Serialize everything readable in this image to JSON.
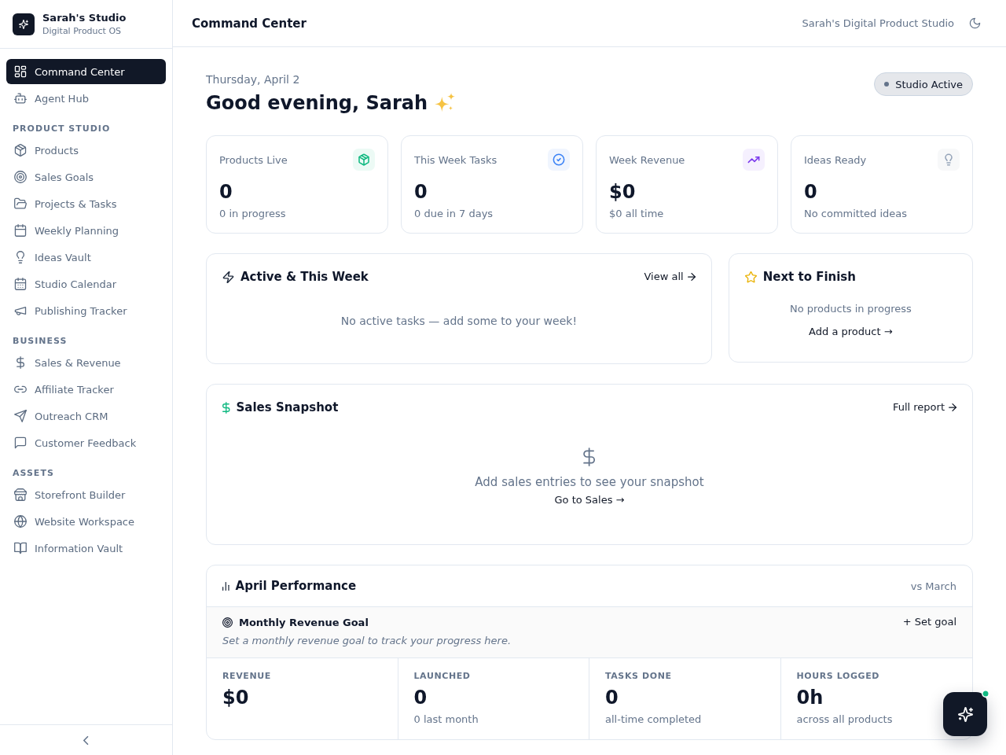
{
  "sidebar": {
    "brand": {
      "title": "Sarah's Studio",
      "subtitle": "Digital Product OS"
    },
    "sections": [
      {
        "items": [
          {
            "label": "Command Center",
            "selected": true
          },
          {
            "label": "Agent Hub",
            "selected": false
          }
        ]
      },
      {
        "heading": "PRODUCT STUDIO",
        "items": [
          {
            "label": "Products",
            "selected": false
          },
          {
            "label": "Sales Goals",
            "selected": false
          },
          {
            "label": "Projects & Tasks",
            "selected": false
          },
          {
            "label": "Weekly Planning",
            "selected": false
          },
          {
            "label": "Ideas Vault",
            "selected": false
          },
          {
            "label": "Studio Calendar",
            "selected": false
          },
          {
            "label": "Publishing Tracker",
            "selected": false
          }
        ]
      },
      {
        "heading": "BUSINESS",
        "items": [
          {
            "label": "Sales & Revenue",
            "selected": false
          },
          {
            "label": "Affiliate Tracker",
            "selected": false
          },
          {
            "label": "Outreach CRM",
            "selected": false
          },
          {
            "label": "Customer Feedback",
            "selected": false
          }
        ]
      },
      {
        "heading": "ASSETS",
        "items": [
          {
            "label": "Storefront Builder",
            "selected": false
          },
          {
            "label": "Website Workspace",
            "selected": false
          },
          {
            "label": "Information Vault",
            "selected": false
          }
        ]
      }
    ]
  },
  "header": {
    "title": "Command Center",
    "studio": "Sarah's Digital Product Studio"
  },
  "greeting": {
    "date": "Thursday, April 2",
    "text": "Good evening, Sarah",
    "status": "Studio Active"
  },
  "stats": [
    {
      "label": "Products Live",
      "value": "0",
      "caption": "0 in progress"
    },
    {
      "label": "This Week Tasks",
      "value": "0",
      "caption": "0 due in 7 days"
    },
    {
      "label": "Week Revenue",
      "value": "$0",
      "caption": "$0 all time"
    },
    {
      "label": "Ideas Ready",
      "value": "0",
      "caption": "No committed ideas"
    }
  ],
  "active_tasks": {
    "title": "Active & This Week",
    "link": "View all",
    "empty": "No active tasks — add some to your week!"
  },
  "next_to_finish": {
    "title": "Next to Finish",
    "empty": "No products in progress",
    "action": "Add a product →"
  },
  "sales_snapshot": {
    "title": "Sales Snapshot",
    "link": "Full report",
    "empty": "Add sales entries to see your snapshot",
    "action": "Go to Sales →"
  },
  "performance": {
    "title": "April Performance",
    "comparison": "vs March",
    "goal": {
      "title": "Monthly Revenue Goal",
      "action": "+ Set goal",
      "hint": "Set a monthly revenue goal to track your progress here."
    },
    "metrics": [
      {
        "label": "REVENUE",
        "value": "$0"
      },
      {
        "label": "LAUNCHED",
        "value": "0",
        "caption": "0 last month"
      },
      {
        "label": "TASKS DONE",
        "value": "0",
        "caption": "all-time completed"
      },
      {
        "label": "HOURS LOGGED",
        "value": "0h",
        "caption": "across all products"
      }
    ]
  }
}
